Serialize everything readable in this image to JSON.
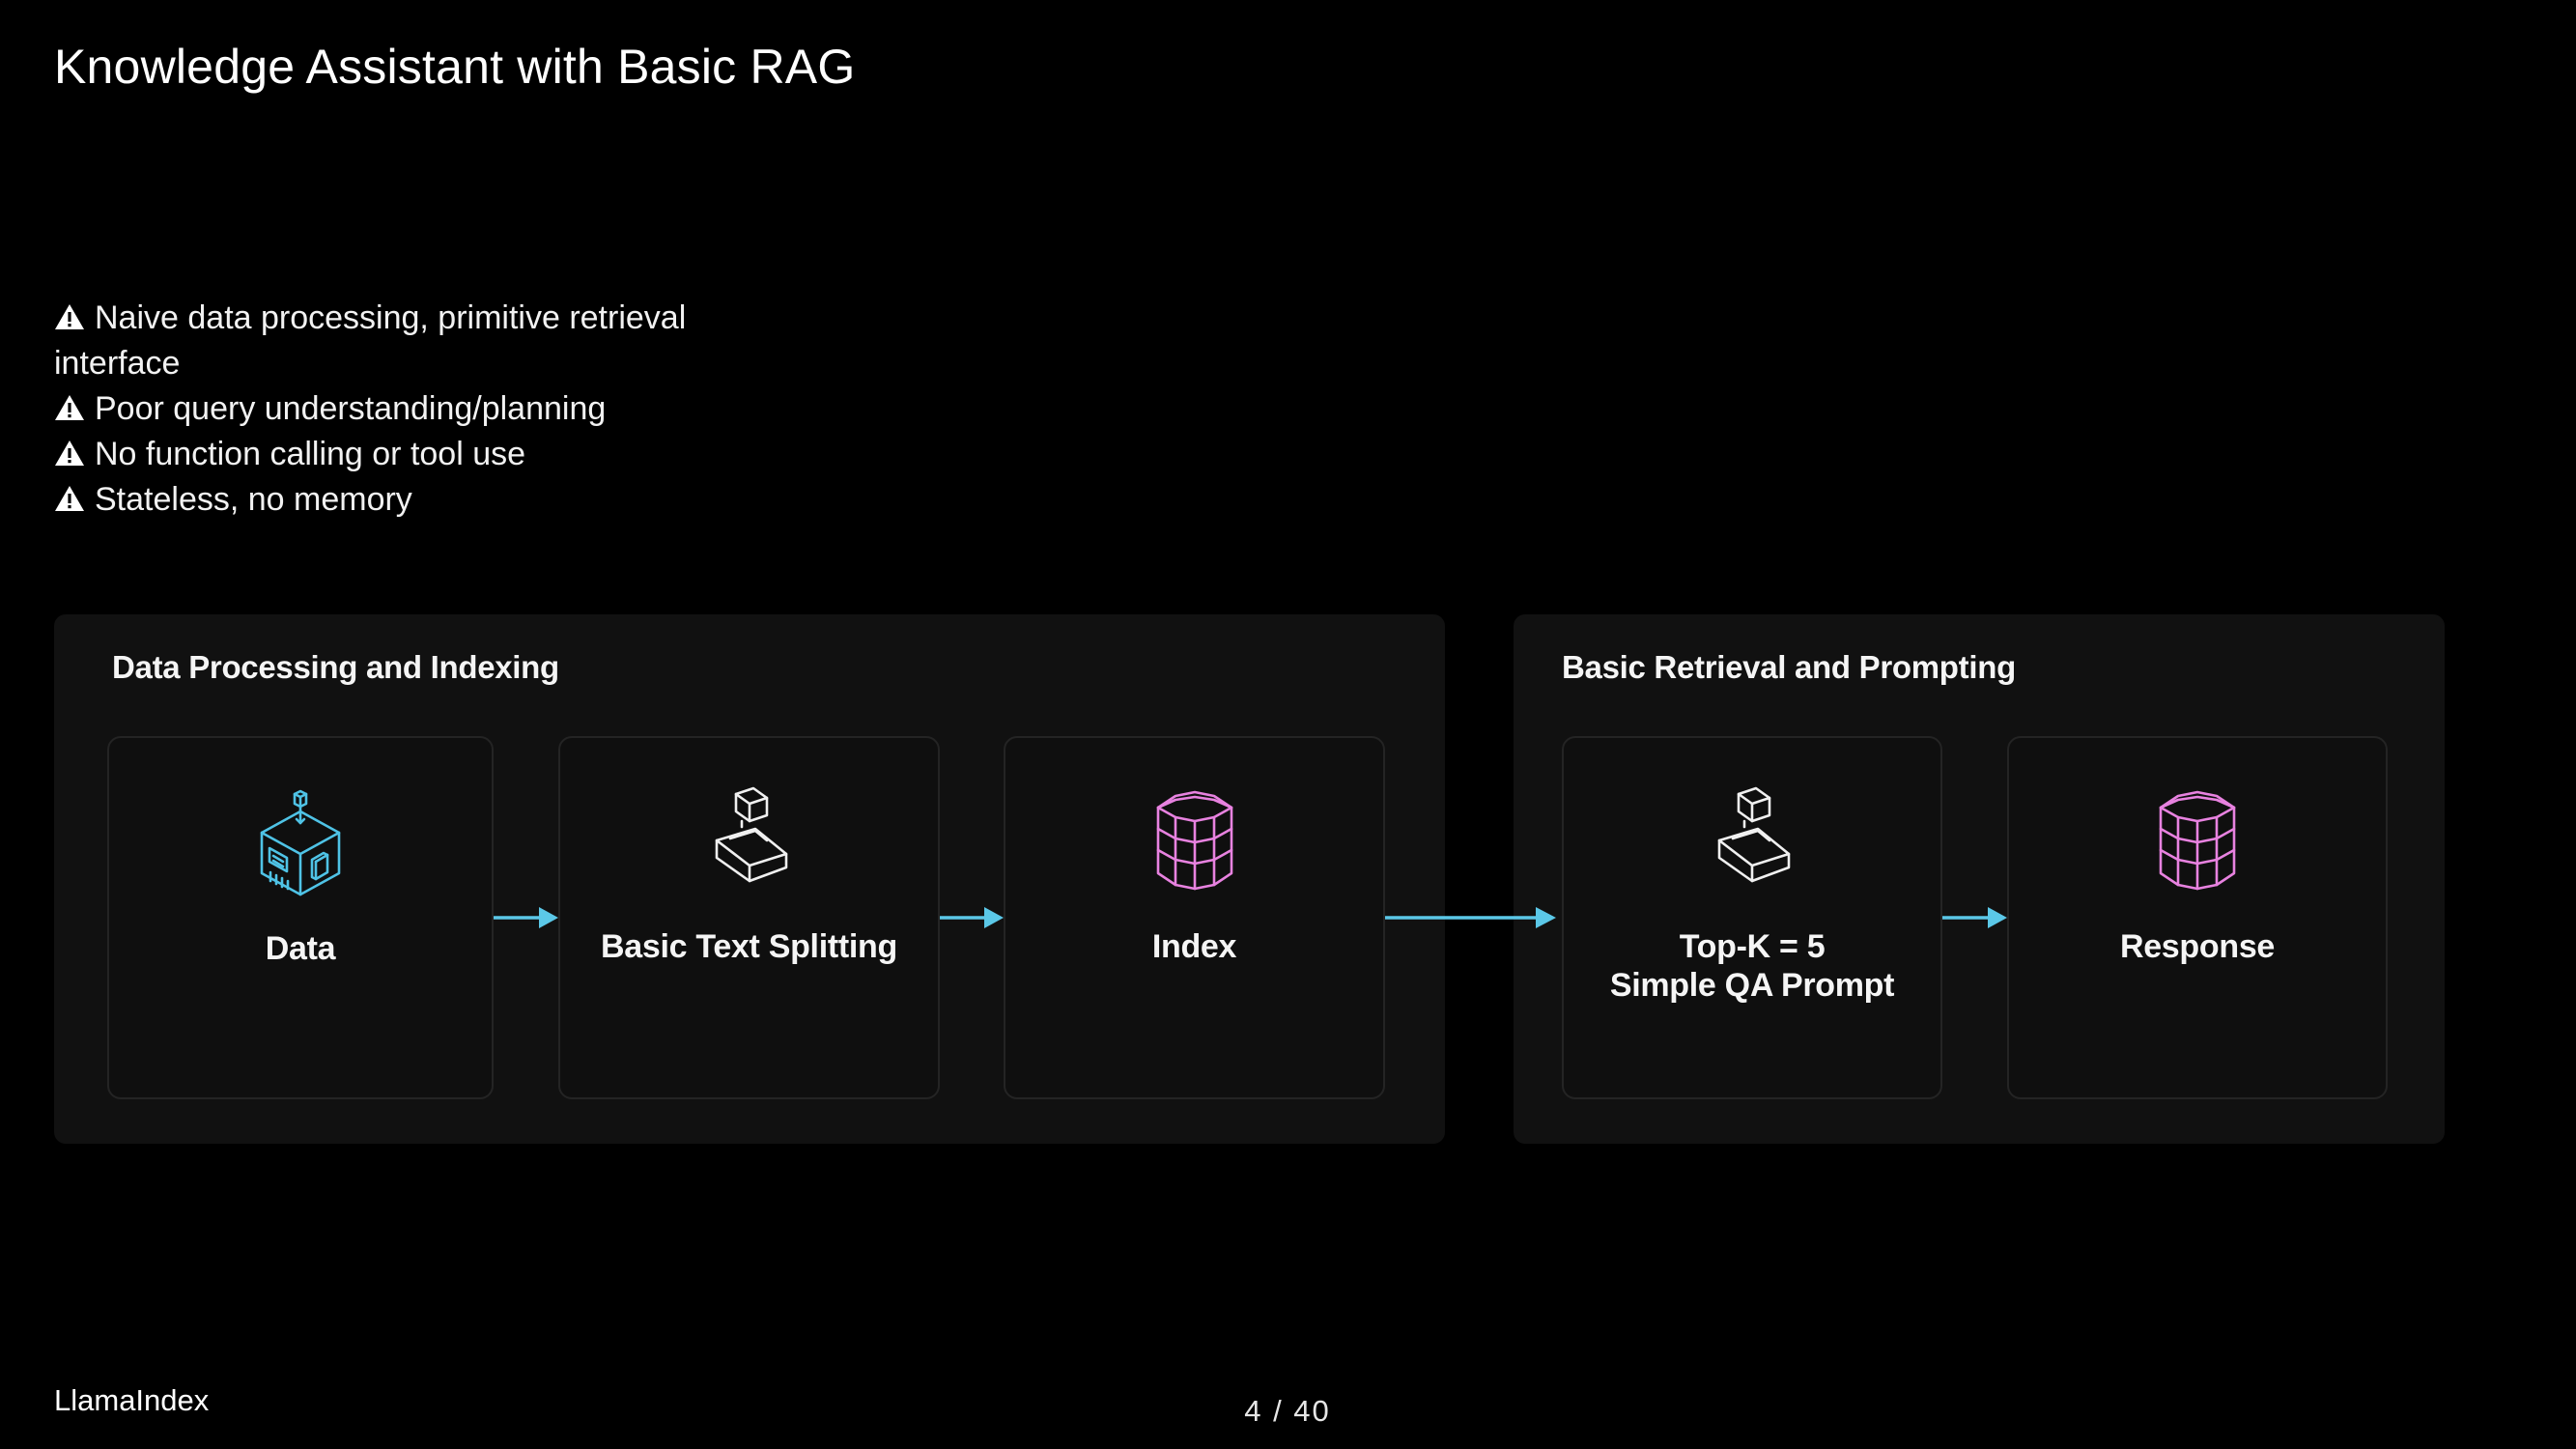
{
  "slide": {
    "title": "Knowledge Assistant with Basic RAG"
  },
  "limitations": {
    "items": [
      "Naive data processing, primitive retrieval interface",
      "Poor query understanding/planning",
      "No function calling or tool use",
      "Stateless, no memory"
    ],
    "icon": "warning-icon"
  },
  "pipeline": {
    "sections": [
      {
        "title": "Data Processing and Indexing",
        "nodes": [
          {
            "label": "Data",
            "icon": "data-building-icon"
          },
          {
            "label": "Basic Text Splitting",
            "icon": "splitter-icon"
          },
          {
            "label": "Index",
            "icon": "database-icon"
          }
        ]
      },
      {
        "title": "Basic Retrieval and Prompting",
        "nodes": [
          {
            "label_lines": [
              "Top-K = 5",
              "Simple QA Prompt"
            ],
            "icon": "splitter-icon"
          },
          {
            "label": "Response",
            "icon": "database-icon"
          }
        ]
      }
    ],
    "colors": {
      "arrow": "#5bc8e8",
      "data_icon": "#4fc3e6",
      "database_icon": "#e882e0",
      "panel_bg": "#111111",
      "node_border": "#242424"
    }
  },
  "footer": {
    "brand": "LlamaIndex",
    "page_current": "4",
    "page_total": "40",
    "page_label": "4 / 40"
  }
}
